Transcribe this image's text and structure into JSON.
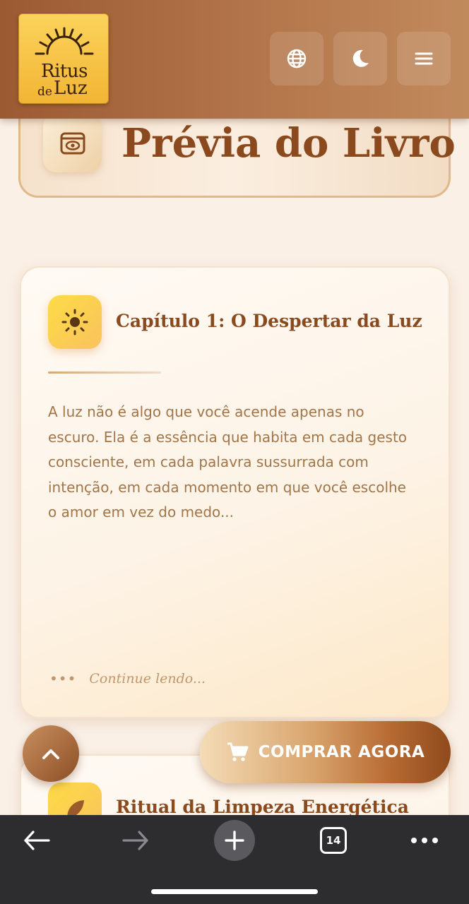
{
  "header": {
    "logo_line1": "Ritus",
    "logo_line2_small": "de",
    "logo_line2_large": "Luz",
    "buttons": [
      "globe-icon",
      "moon-icon",
      "menu-icon"
    ]
  },
  "page": {
    "title": "Prévia do Livro",
    "title_icon": "eye-icon"
  },
  "chapters": [
    {
      "title": "Capítulo 1: O Despertar da Luz",
      "icon": "sun-icon",
      "excerpt": "A luz não é algo que você acende apenas no escuro. Ela é a essência que habita em cada gesto consciente, em cada palavra sussurrada com intenção, em cada momento em que você escolhe o amor em vez do medo...",
      "continue_label": "Continue lendo..."
    },
    {
      "title": "Ritual da Limpeza Energética",
      "icon": "leaf-icon"
    }
  ],
  "actions": {
    "buy_label": "COMPRAR AGORA",
    "buy_icon": "cart-icon",
    "scroll_top_icon": "chevron-up-icon"
  },
  "browser": {
    "tab_count": "14"
  },
  "colors": {
    "brand_brown": "#8a4a1e",
    "logo_gold": "#f6c244",
    "background": "#faf0e6"
  }
}
